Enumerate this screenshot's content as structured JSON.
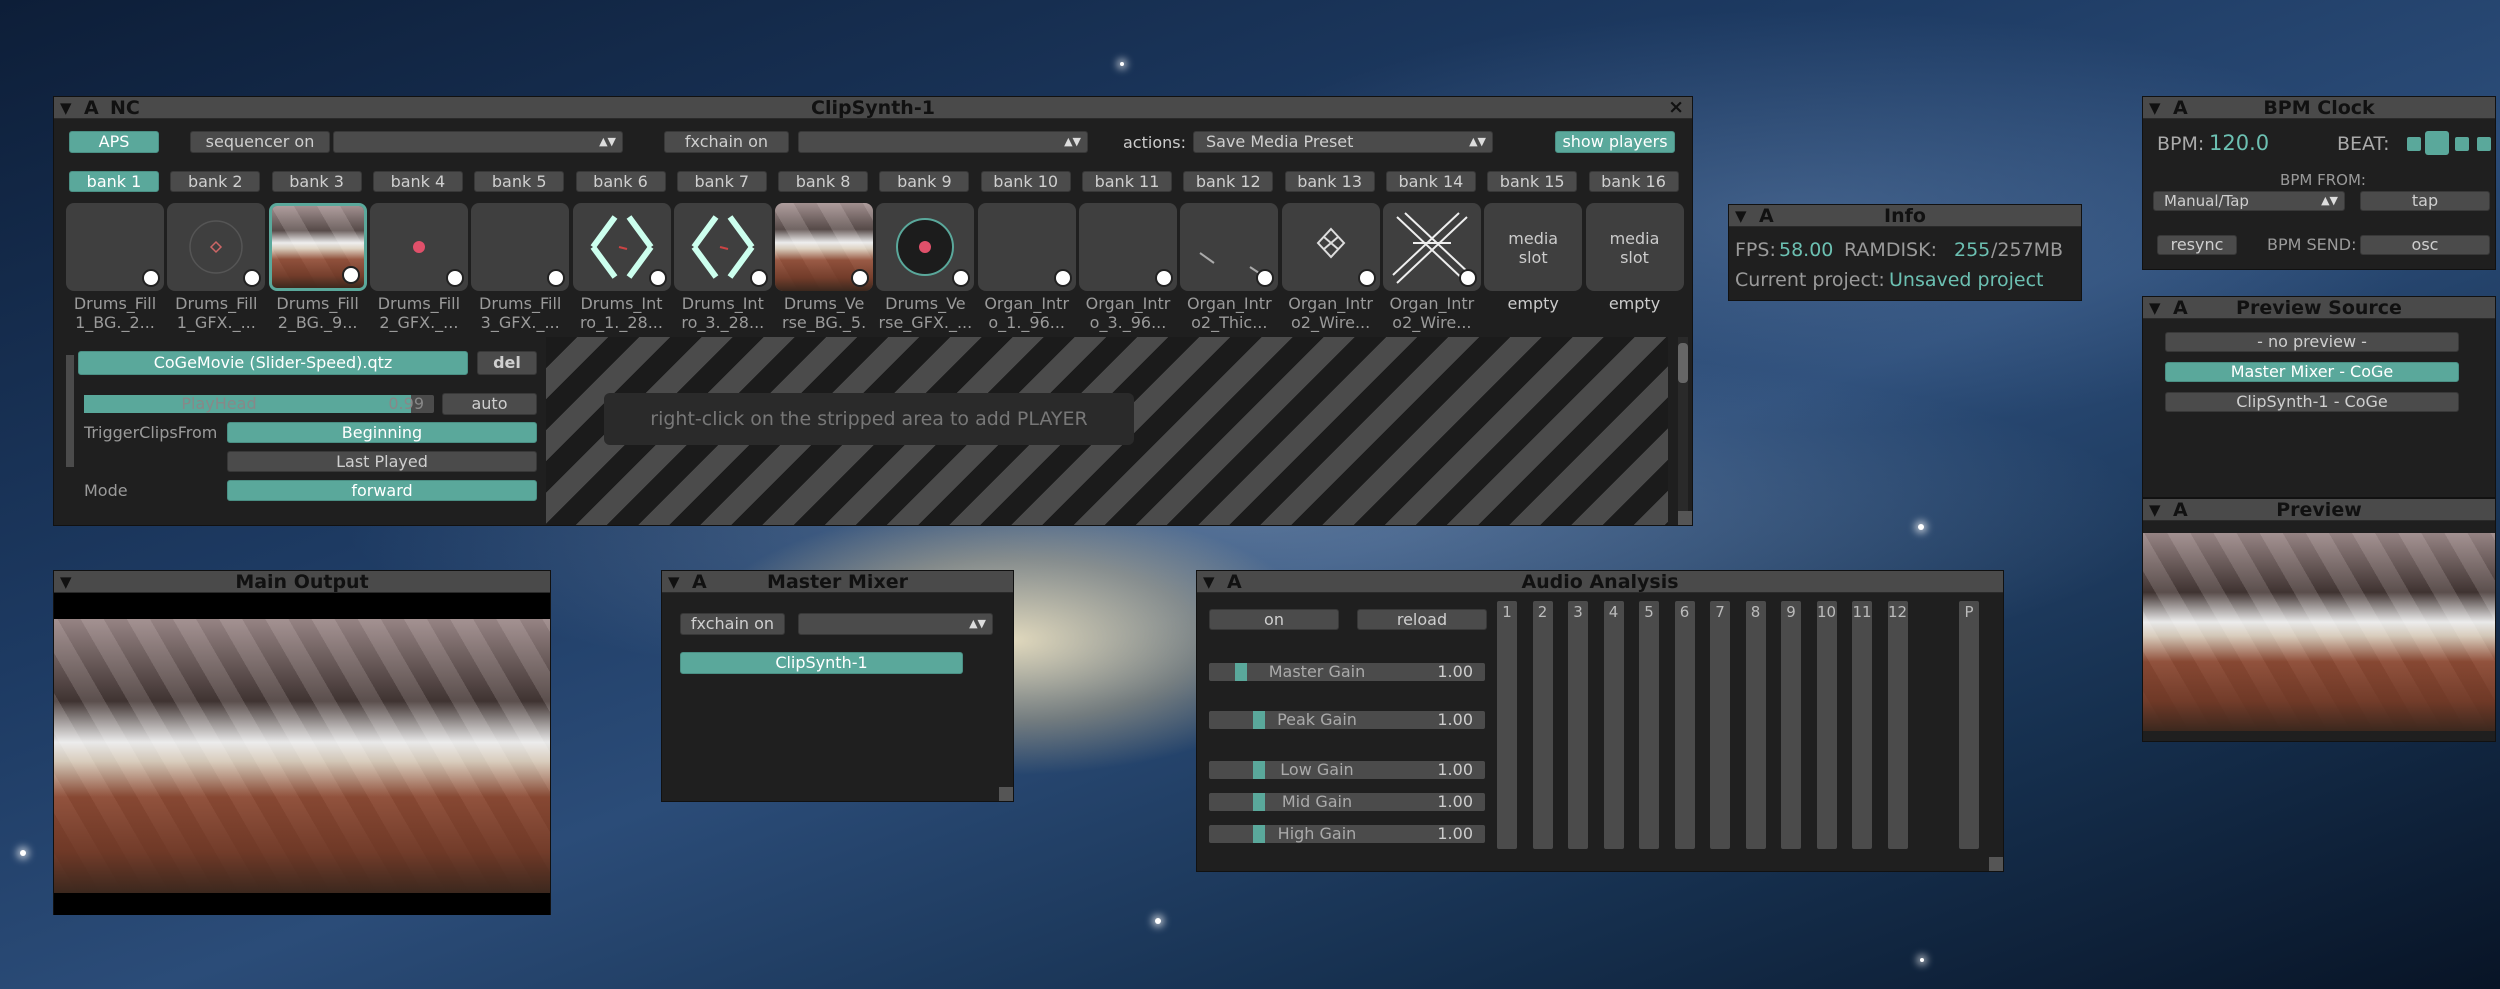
{
  "clipsynth": {
    "tag_a": "A",
    "tag_nc": "NC",
    "title": "ClipSynth-1",
    "close": "×",
    "aps": "APS",
    "sequencer": "sequencer on",
    "fxchain": "fxchain on",
    "actions_label": "actions:",
    "actions_value": "Save Media Preset",
    "show_players": "show players",
    "banks": [
      "bank 1",
      "bank 2",
      "bank 3",
      "bank 4",
      "bank 5",
      "bank 6",
      "bank 7",
      "bank 8",
      "bank 9",
      "bank 10",
      "bank 11",
      "bank 12",
      "bank 13",
      "bank 14",
      "bank 15",
      "bank 16"
    ],
    "clips": [
      "Drums_Fill\n1_BG._2...",
      "Drums_Fill\n1_GFX._...",
      "Drums_Fill\n2_BG._9...",
      "Drums_Fill\n2_GFX._...",
      "Drums_Fill\n3_GFX._...",
      "Drums_Int\nro_1._28...",
      "Drums_Int\nro_3._28...",
      "Drums_Ve\nrse_BG._5.",
      "Drums_Ve\nrse_GFX._...",
      "Organ_Intr\no_1._96...",
      "Organ_Intr\no_3._96...",
      "Organ_Intr\no2_Thic...",
      "Organ_Intr\no2_Wire...",
      "Organ_Intr\no2_Wire...",
      "empty",
      "empty"
    ],
    "media_slot": "media\nslot",
    "player": {
      "movie": "CoGeMovie (Slider-Speed).qtz",
      "del": "del",
      "playhead_label": "PlayHead",
      "playhead_value": "0.99",
      "playhead_fraction": 0.99,
      "auto": "auto",
      "trigger_label": "TriggerClipsFrom",
      "trigger_beginning": "Beginning",
      "trigger_last": "Last Played",
      "mode_label": "Mode",
      "mode_value": "forward"
    },
    "hint": "right-click on the stripped area to add PLAYER"
  },
  "info": {
    "tag": "A",
    "title": "Info",
    "fps_label": "FPS:",
    "fps_value": "58.00",
    "ramdisk_label": "RAMDISK:",
    "ramdisk_used": "255",
    "ramdisk_total": "/257MB",
    "project_label": "Current project:",
    "project_value": "Unsaved project"
  },
  "bpm": {
    "tag": "A",
    "title": "BPM Clock",
    "bpm_label": "BPM:",
    "bpm_value": "120.0",
    "beat_label": "BEAT:",
    "from_label": "BPM FROM:",
    "from_value": "Manual/Tap",
    "tap": "tap",
    "resync": "resync",
    "send_label": "BPM SEND:",
    "send_value": "osc"
  },
  "preview_source": {
    "tag": "A",
    "title": "Preview Source",
    "items": [
      "- no preview -",
      "Master Mixer - CoGe",
      "ClipSynth-1 - CoGe"
    ]
  },
  "preview": {
    "tag": "A",
    "title": "Preview"
  },
  "main_output": {
    "title": "Main Output"
  },
  "master_mixer": {
    "tag": "A",
    "title": "Master Mixer",
    "fxchain": "fxchain on",
    "channel": "ClipSynth-1"
  },
  "audio": {
    "tag": "A",
    "title": "Audio Analysis",
    "on": "on",
    "reload": "reload",
    "gains": [
      {
        "name": "Master Gain",
        "value": "1.00"
      },
      {
        "name": "Peak Gain",
        "value": "1.00"
      },
      {
        "name": "Low Gain",
        "value": "1.00"
      },
      {
        "name": "Mid Gain",
        "value": "1.00"
      },
      {
        "name": "High Gain",
        "value": "1.00"
      }
    ],
    "channels": [
      "1",
      "2",
      "3",
      "4",
      "5",
      "6",
      "7",
      "8",
      "9",
      "10",
      "11",
      "12",
      "P"
    ]
  },
  "colors": {
    "accent": "#5aa89b",
    "panel": "#1f1f1f",
    "control": "#4b4b4b"
  }
}
